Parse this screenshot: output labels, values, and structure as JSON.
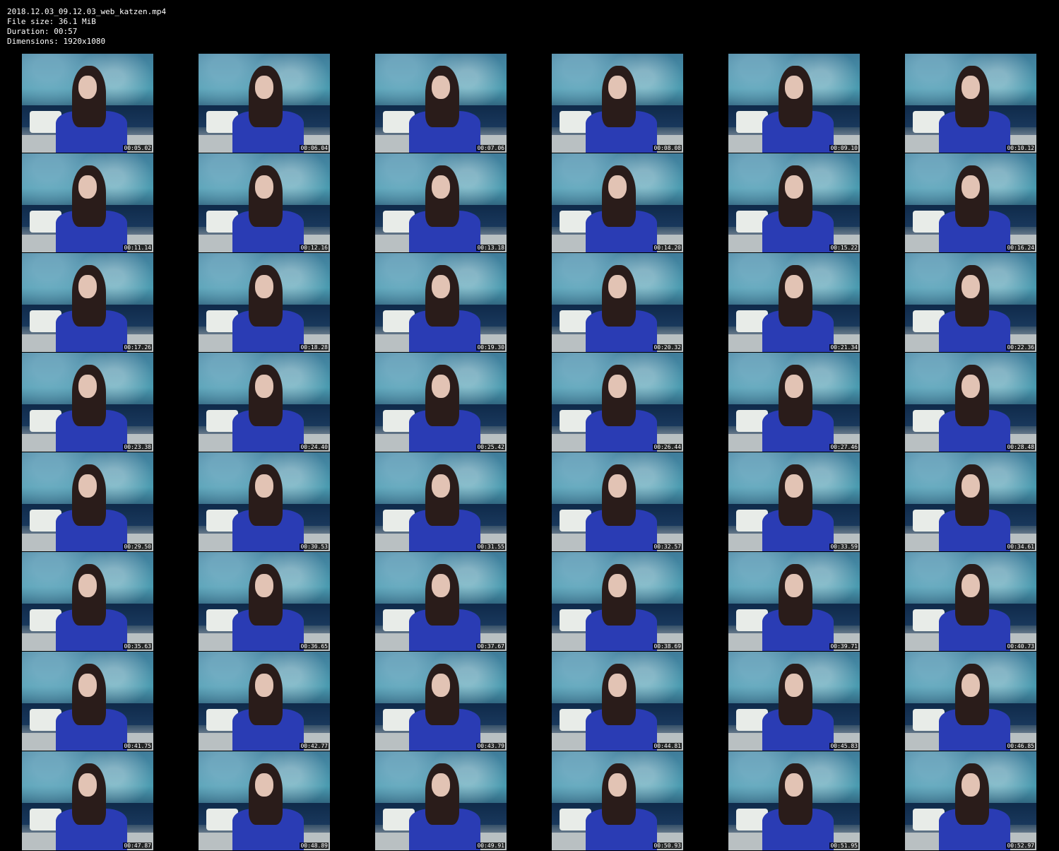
{
  "info": {
    "filename": "2018.12.03_09.12.03_web_katzen.mp4",
    "file_size": "File size: 36.1 MiB",
    "duration": "Duration: 00:57",
    "dimensions": "Dimensions: 1920x1080"
  },
  "timestamps": [
    "00:05.02",
    "00:06.04",
    "00:07.06",
    "00:08.08",
    "00:09.10",
    "00:10.12",
    "00:11.14",
    "00:12.16",
    "00:13.18",
    "00:14.20",
    "00:15.22",
    "00:16.24",
    "00:17.26",
    "00:18.28",
    "00:19.30",
    "00:20.32",
    "00:21.34",
    "00:22.36",
    "00:23.38",
    "00:24.40",
    "00:25.42",
    "00:26.44",
    "00:27.46",
    "00:28.48",
    "00:29.50",
    "00:30.53",
    "00:31.55",
    "00:32.57",
    "00:33.59",
    "00:34.61",
    "00:35.63",
    "00:36.65",
    "00:37.67",
    "00:38.69",
    "00:39.71",
    "00:40.73",
    "00:41.75",
    "00:42.77",
    "00:43.79",
    "00:44.81",
    "00:45.83",
    "00:46.85",
    "00:47.87",
    "00:48.89",
    "00:49.91",
    "00:50.93",
    "00:51.95",
    "00:52.97"
  ]
}
